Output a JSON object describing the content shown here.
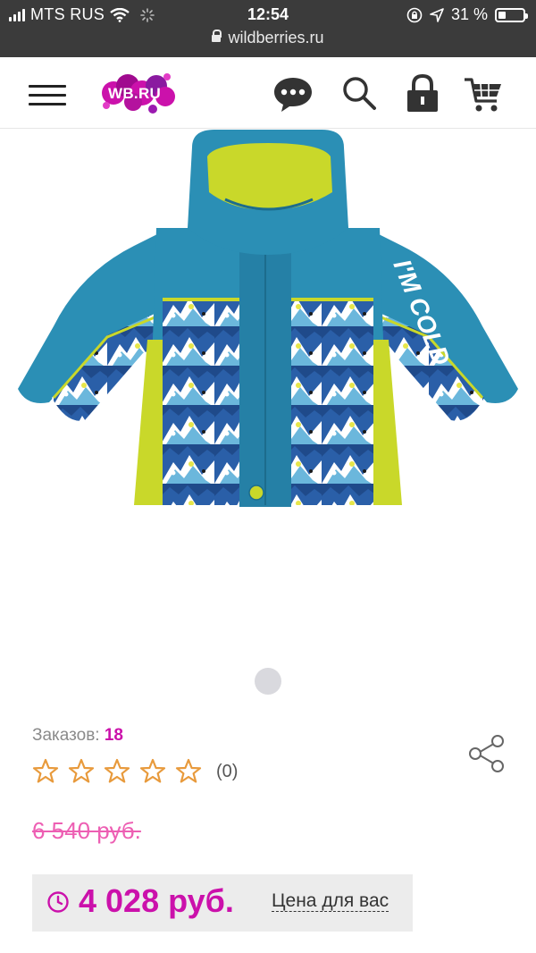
{
  "status_bar": {
    "carrier": "MTS RUS",
    "time": "12:54",
    "battery_text": "31 %",
    "battery_level": 0.31,
    "url": "wildberries.ru"
  },
  "header": {
    "logo_text": "WB.RU",
    "icons": [
      "menu-icon",
      "chat-icon",
      "search-icon",
      "lock-icon",
      "cart-icon"
    ]
  },
  "gallery": {
    "image_alt": "Kids winter jacket",
    "slides": 1,
    "active_slide": 1
  },
  "product": {
    "orders_label": "Заказов:",
    "orders_value": "18",
    "rating_stars": 0,
    "rating_count": "(0)",
    "old_price": "6 540 руб.",
    "price": "4 028 руб.",
    "price_label": "Цена для вас"
  },
  "colors": {
    "brand": "#cb11ab",
    "old_price": "#ed5fb3",
    "star": "#e89a3c",
    "jacket_main": "#2b8fb5",
    "jacket_lime": "#c9d82a"
  }
}
